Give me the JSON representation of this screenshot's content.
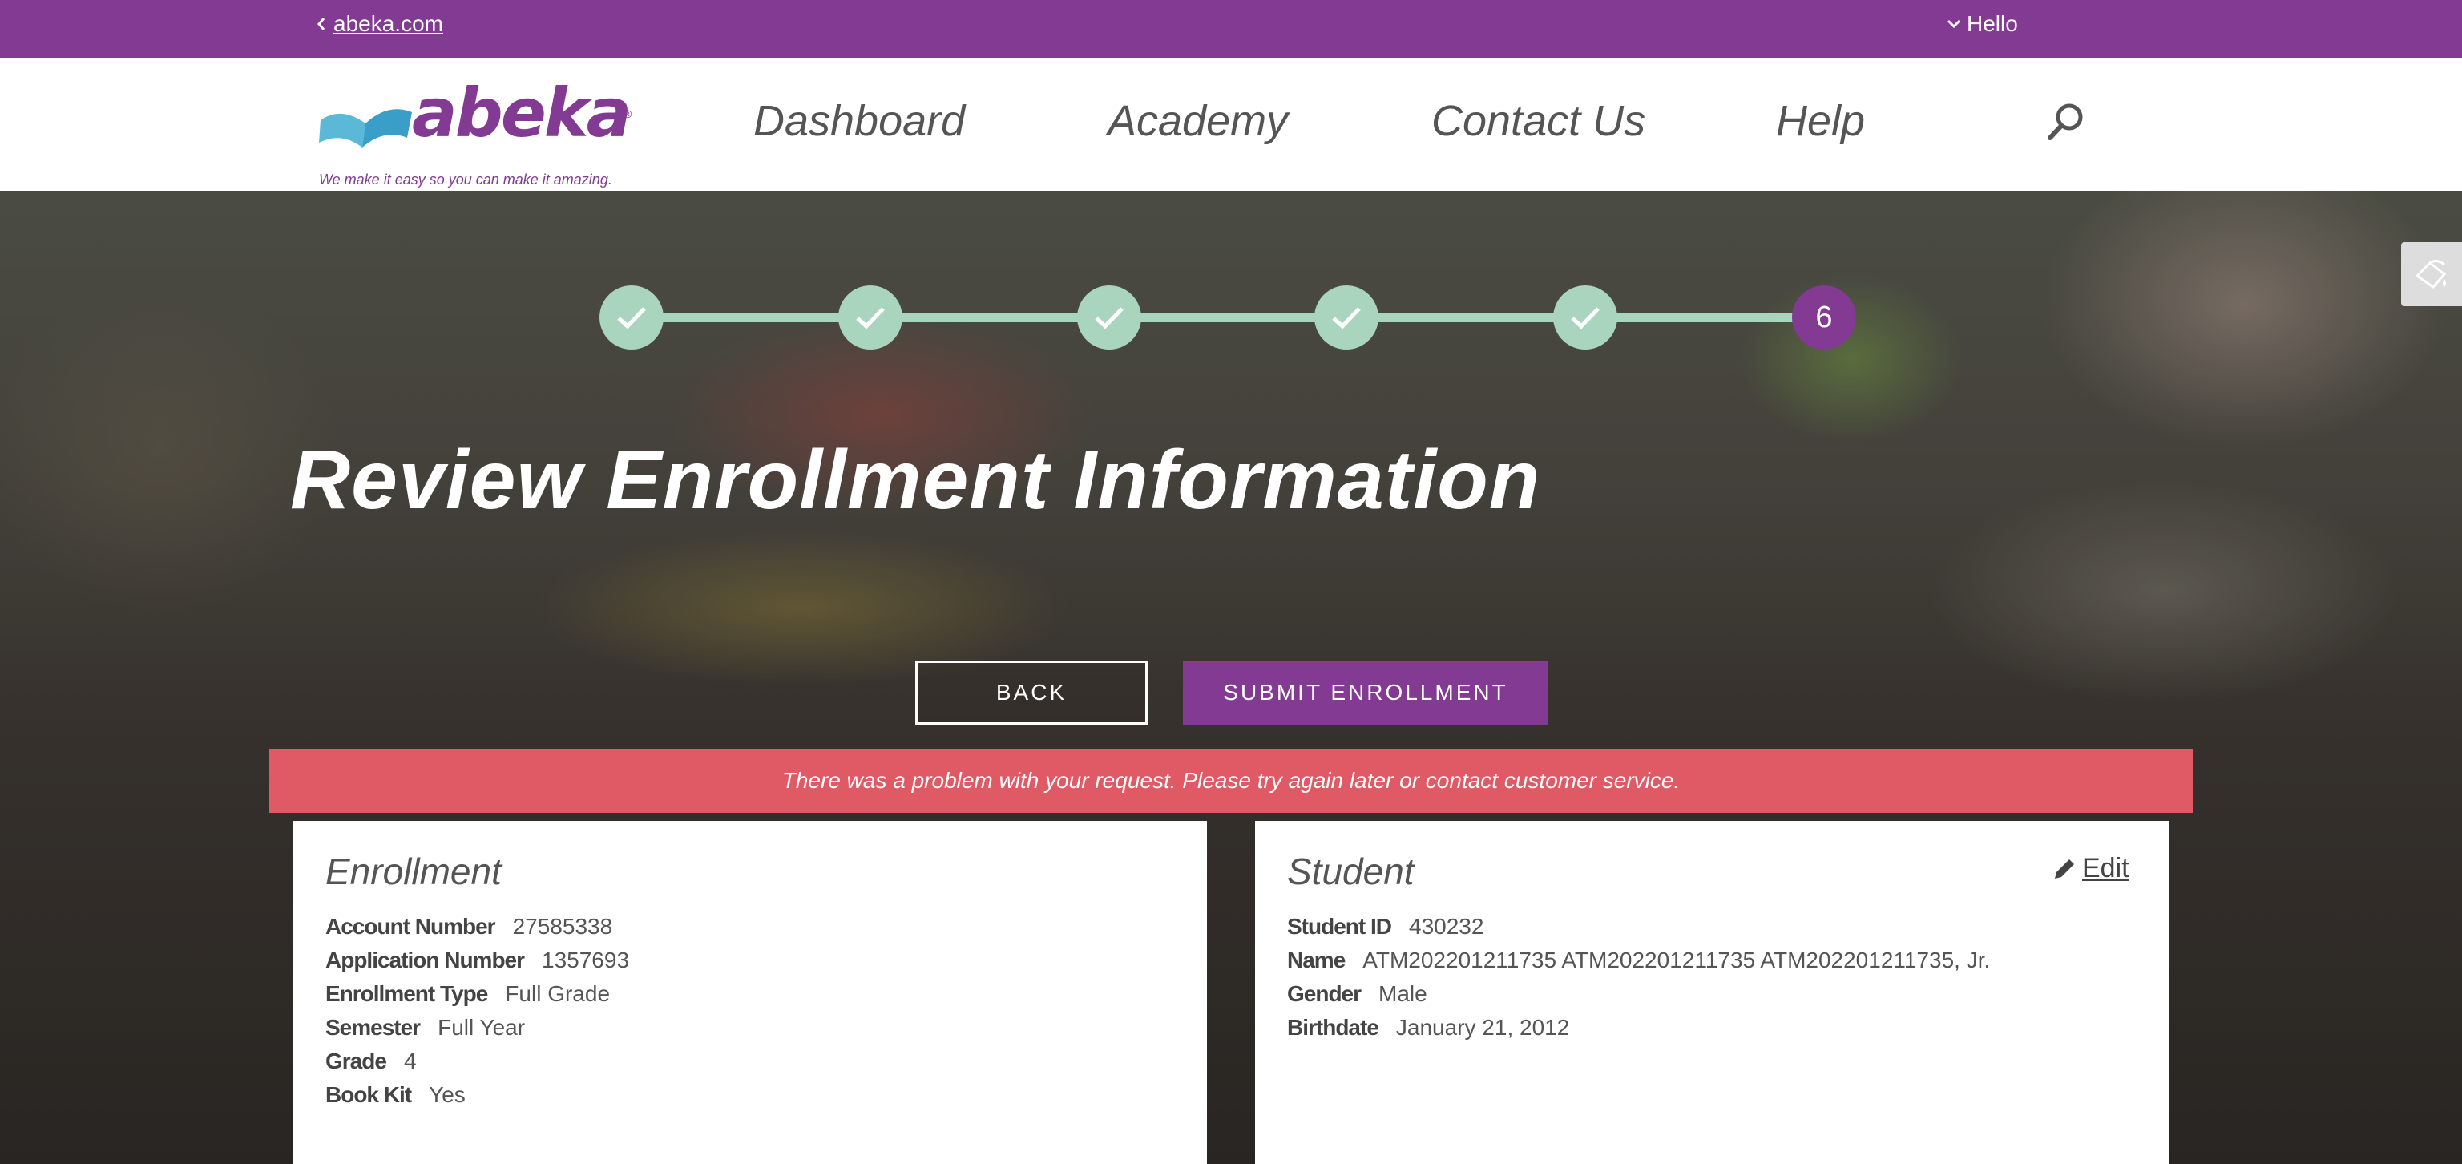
{
  "topbar": {
    "back_label": "abeka.com",
    "greeting": "Hello"
  },
  "brand": {
    "logo_text": "abeka",
    "registered": "®",
    "tagline": "We make it easy so you can make it amazing."
  },
  "nav": {
    "items": [
      {
        "label": "Dashboard"
      },
      {
        "label": "Academy"
      },
      {
        "label": "Contact Us"
      },
      {
        "label": "Help"
      }
    ]
  },
  "stepper": {
    "steps": [
      {
        "state": "complete"
      },
      {
        "state": "complete"
      },
      {
        "state": "complete"
      },
      {
        "state": "complete"
      },
      {
        "state": "complete"
      },
      {
        "state": "active",
        "label": "6"
      }
    ]
  },
  "page": {
    "title": "Review Enrollment Information"
  },
  "actions": {
    "back_label": "BACK",
    "submit_label": "SUBMIT ENROLLMENT"
  },
  "alert": {
    "message": "There was a problem with your request. Please try again later or contact customer service."
  },
  "enrollment": {
    "heading": "Enrollment",
    "fields": [
      {
        "label": "Account Number",
        "value": "27585338"
      },
      {
        "label": "Application Number",
        "value": "1357693"
      },
      {
        "label": "Enrollment Type",
        "value": "Full Grade"
      },
      {
        "label": "Semester",
        "value": "Full Year"
      },
      {
        "label": "Grade",
        "value": "4"
      },
      {
        "label": "Book Kit",
        "value": "Yes"
      }
    ]
  },
  "student": {
    "heading": "Student",
    "edit_label": "Edit",
    "fields": [
      {
        "label": "Student ID",
        "value": "430232"
      },
      {
        "label": "Name",
        "value": "ATM202201211735 ATM202201211735 ATM202201211735, Jr."
      },
      {
        "label": "Gender",
        "value": "Male"
      },
      {
        "label": "Birthdate",
        "value": "January 21, 2012"
      }
    ]
  },
  "colors": {
    "brand_purple": "#823a93",
    "step_complete": "#a9d4bd",
    "alert_red": "#e05a66"
  },
  "icons": {
    "back": "chevron-left-icon",
    "hello": "chevron-down-icon",
    "search": "search-icon",
    "step_complete": "check-icon",
    "edit": "pencil-icon",
    "side_tab": "paint-bucket-icon"
  }
}
